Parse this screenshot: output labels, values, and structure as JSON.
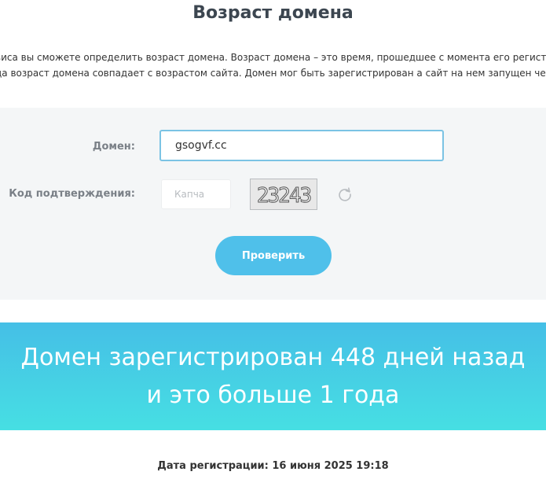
{
  "page": {
    "title": "Возраст домена",
    "description_line1": "виса вы сможете определить возраст домена. Возраст домена – это время, прошедшее с момента его регистрации",
    "description_line2": "да возраст домена совпадает с возрастом сайта. Домен мог быть зарегистрирован а сайт на нем запущен через"
  },
  "form": {
    "domain_label": "Домен:",
    "domain_value": "gsogvf.cc",
    "captcha_label": "Код подтверждения:",
    "captcha_placeholder": "Капча",
    "captcha_image_text": "23243",
    "refresh_icon": "refresh-icon",
    "submit_label": "Проверить",
    "accent_color": "#4fc0ea"
  },
  "result": {
    "line1": "Домен зарегистрирован 448 дней назад",
    "line2": "и это больше 1 года",
    "registration_date": "Дата регистрации: 16 июня 2025 19:18",
    "gradient_top": "#45bfe6",
    "gradient_bottom": "#46dfe3"
  }
}
